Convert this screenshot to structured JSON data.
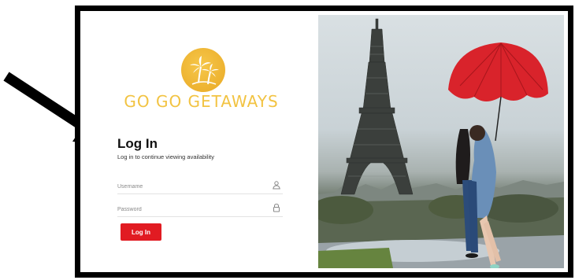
{
  "brand": {
    "name": "GO GO GETAWAYS"
  },
  "login": {
    "title": "Log In",
    "subtitle": "Log in to continue viewing availability",
    "username_placeholder": "Username",
    "password_placeholder": "Password",
    "button_label": "Log In"
  },
  "icons": {
    "logo": "palm-trees-logo-icon",
    "username": "user-icon",
    "password": "lock-icon",
    "pointer": "arrow-pointer-icon"
  },
  "colors": {
    "brand_gold": "#f2c342",
    "button_red": "#e11b22",
    "umbrella_red": "#d9232b",
    "frame": "#000000"
  }
}
